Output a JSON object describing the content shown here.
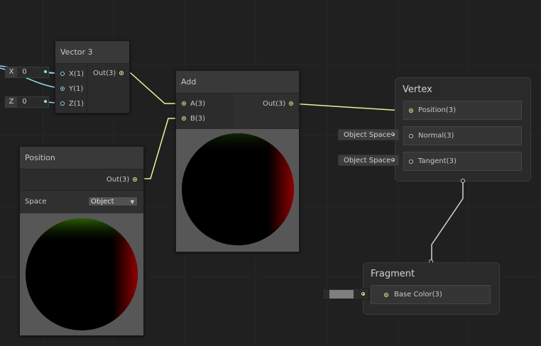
{
  "colors": {
    "background": "#202020",
    "wire_vector": "#f2ef95",
    "wire_float": "#8ee0e6",
    "wire_flow": "#d0d0d0",
    "base_color_swatch": "#7f7f7f"
  },
  "vector3": {
    "title": "Vector 3",
    "inputs": [
      "X(1)",
      "Y(1)",
      "Z(1)"
    ],
    "output": "Out(3)",
    "x_field": {
      "label": "X",
      "value": "0"
    },
    "z_field": {
      "label": "Z",
      "value": "0"
    }
  },
  "add": {
    "title": "Add",
    "inputs": [
      "A(3)",
      "B(3)"
    ],
    "output": "Out(3)"
  },
  "position": {
    "title": "Position",
    "output": "Out(3)",
    "space_label": "Space",
    "space_value": "Object"
  },
  "vertex": {
    "title": "Vertex",
    "blocks": [
      "Position(3)",
      "Normal(3)",
      "Tangent(3)"
    ],
    "normal_space": "Object Space",
    "tangent_space": "Object Space"
  },
  "fragment": {
    "title": "Fragment",
    "blocks": [
      "Base Color(3)"
    ]
  }
}
